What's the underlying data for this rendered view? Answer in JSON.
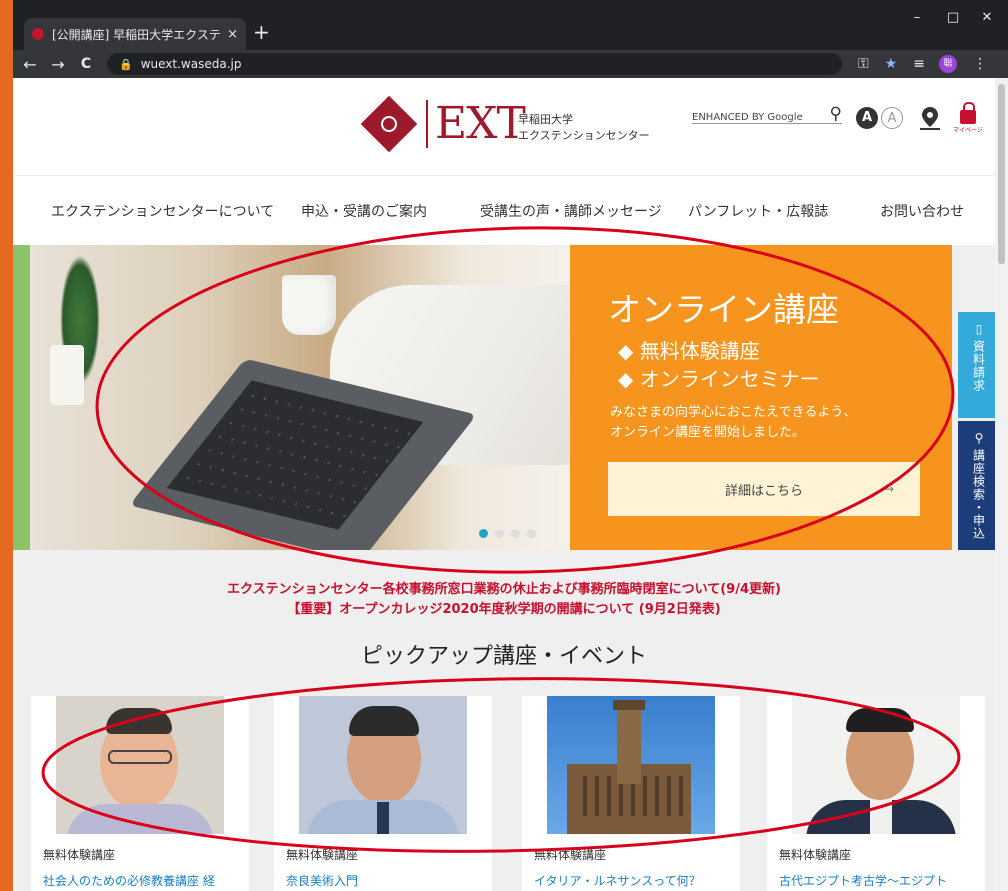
{
  "browser": {
    "tab_title": "[公開講座] 早稲田大学エクステンシ",
    "tab_close": "×",
    "new_tab": "+",
    "url": "wuext.waseda.jp",
    "window_controls": {
      "minimize": "–",
      "maximize": "□",
      "close": "✕"
    },
    "nav": {
      "back": "←",
      "forward": "→",
      "reload": "C"
    },
    "profile_initial": "聡"
  },
  "header": {
    "logo_text": "EXT",
    "logo_sub1": "早稲田大学",
    "logo_sub2": "エクステンションセンター",
    "search_label": "ENHANCED BY Google",
    "font_large": "A",
    "font_small": "A",
    "mypage_caption": "マイページ"
  },
  "nav": {
    "items": [
      "エクステンションセンターについて",
      "申込・受講のご案内",
      "受講生の声・講師メッセージ",
      "パンフレット・広報誌",
      "お問い合わせ"
    ]
  },
  "hero": {
    "title": "オンライン講座",
    "bullets": [
      "◆ 無料体験講座",
      "◆ オンラインセミナー"
    ],
    "desc1": "みなさまの向学心におこたえできるよう、",
    "desc2": "オンライン講座を開始しました。",
    "button": "詳細はこちら",
    "button_arrow": "→"
  },
  "side_tabs": {
    "doc_icon": "▯",
    "doc_label": "資料請求",
    "search_icon": "⚲",
    "search_label": "講座検索・申込"
  },
  "news": [
    "エクステンションセンター各校事務所窓口業務の休止および事務所臨時閉室について(9/4更新)",
    "【重要】オープンカレッジ2020年度秋学期の開講について (9月2日発表)"
  ],
  "pickup": {
    "title": "ピックアップ講座・イベント",
    "cards": [
      {
        "category": "無料体験講座",
        "title": "社会人のための必修教養講座 経"
      },
      {
        "category": "無料体験講座",
        "title": "奈良美術入門"
      },
      {
        "category": "無料体験講座",
        "title": "イタリア・ルネサンスって何？"
      },
      {
        "category": "無料体験講座",
        "title": "古代エジプト考古学～エジプト"
      }
    ]
  },
  "colors": {
    "brand": "#9d1a2d",
    "hero_orange": "#f7941d",
    "news_red": "#c8102e",
    "link_blue": "#1a7fc1",
    "annotation_red": "#d9001b"
  }
}
